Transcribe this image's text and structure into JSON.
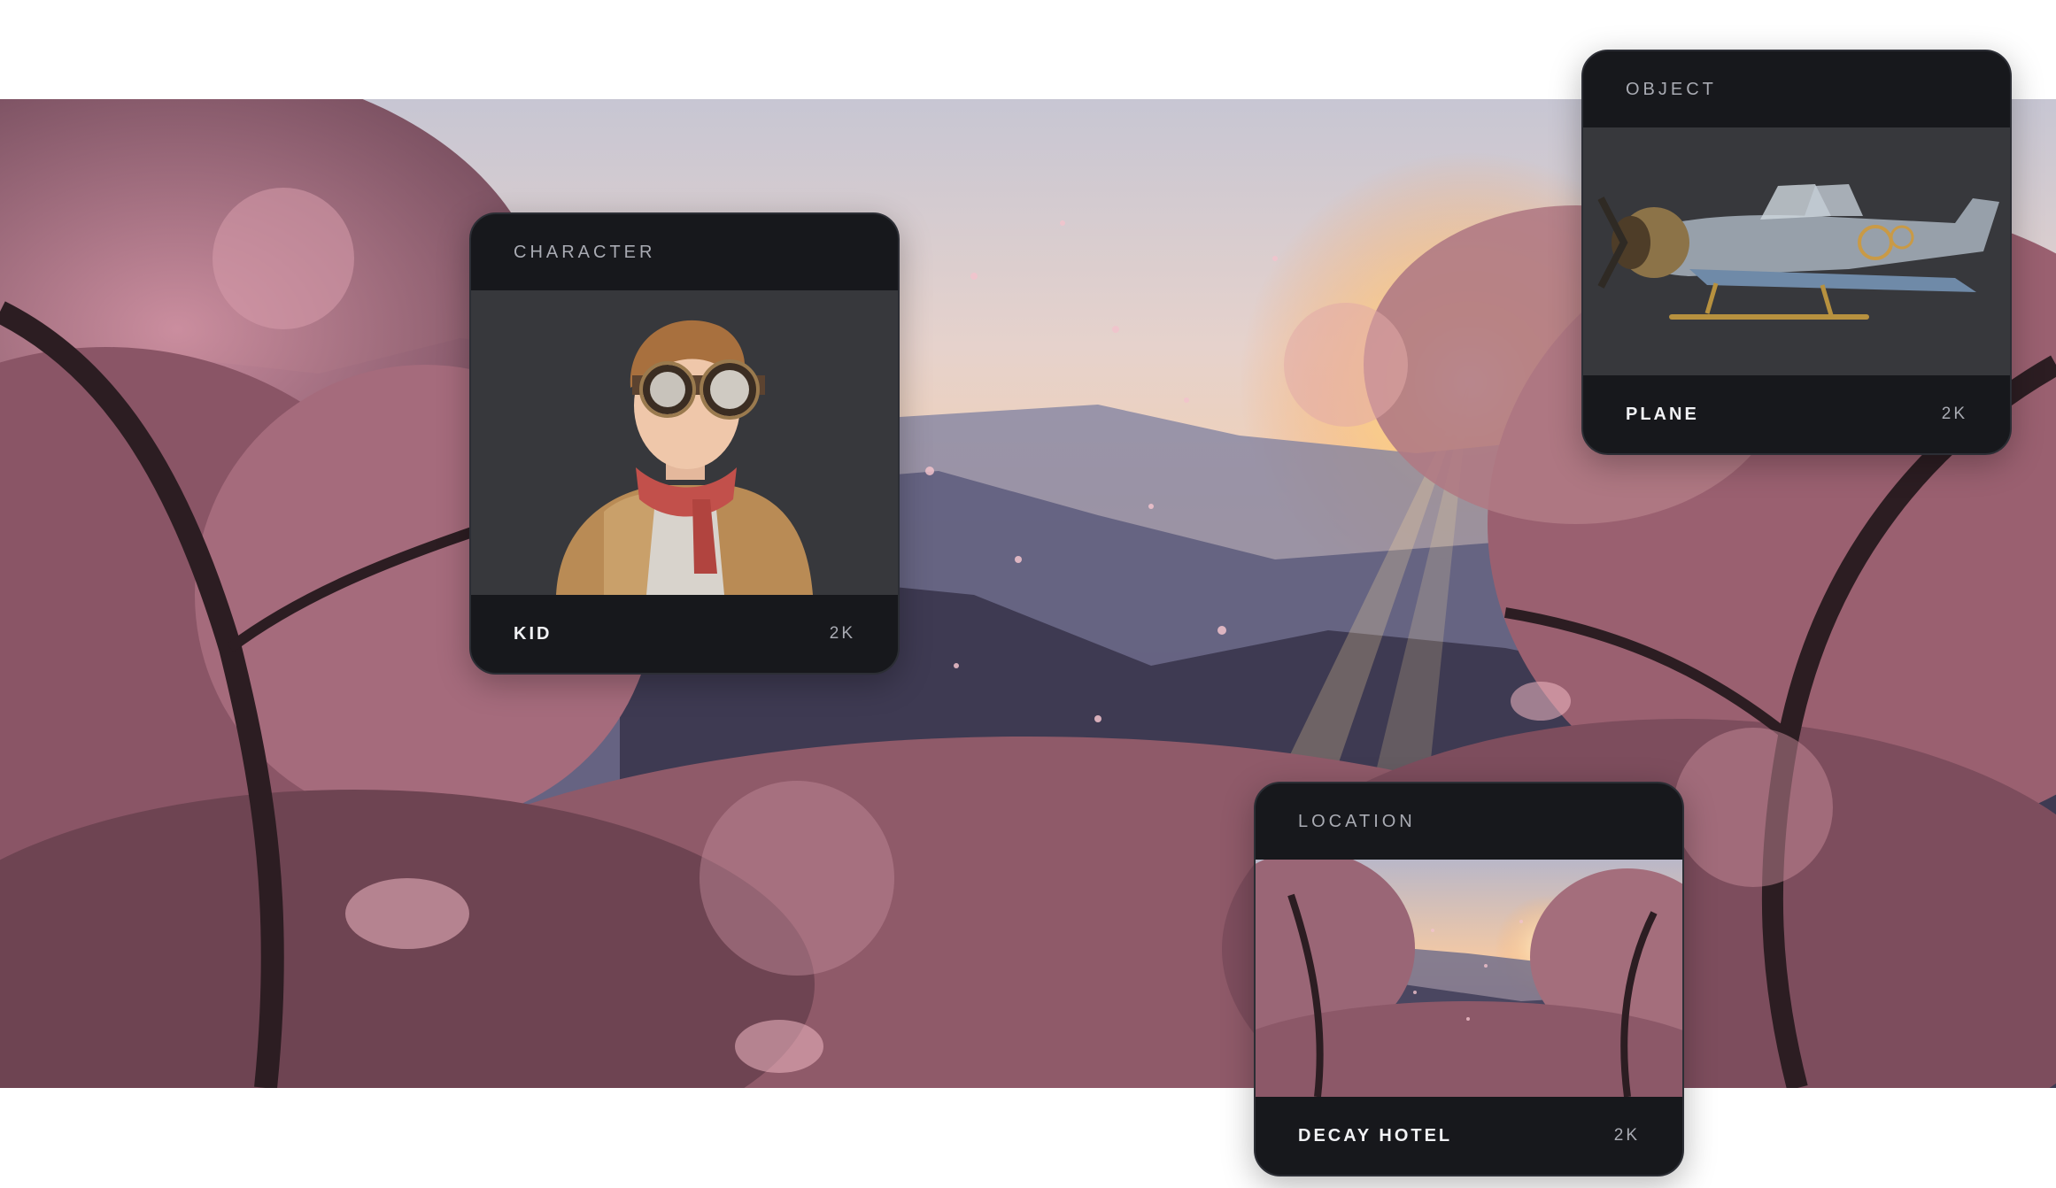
{
  "cards": {
    "character": {
      "category": "CHARACTER",
      "name": "KID",
      "resolution": "2K"
    },
    "object": {
      "category": "OBJECT",
      "name": "PLANE",
      "resolution": "2K"
    },
    "location": {
      "category": "LOCATION",
      "name": "DECAY HOTEL",
      "resolution": "2K"
    }
  },
  "colors": {
    "card_background": "#17181c",
    "media_background": "#37383c",
    "label_muted": "#a9abb3",
    "label_bright": "#f1f2f5",
    "blossom": "#c98a9c"
  }
}
